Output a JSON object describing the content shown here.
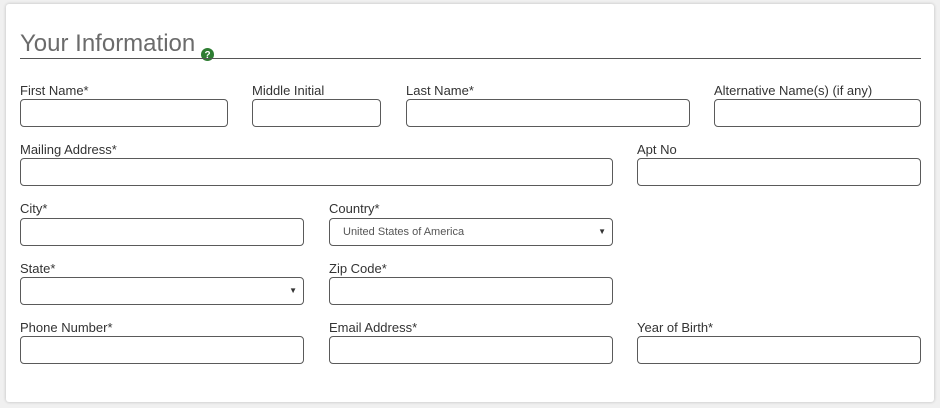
{
  "section": {
    "title": "Your Information",
    "help_icon": "help-circle-icon"
  },
  "fields": {
    "first_name": {
      "label": "First Name*",
      "value": ""
    },
    "middle_initial": {
      "label": "Middle Initial",
      "value": ""
    },
    "last_name": {
      "label": "Last Name*",
      "value": ""
    },
    "alt_name": {
      "label": "Alternative Name(s) (if any)",
      "value": ""
    },
    "mailing_address": {
      "label": "Mailing Address*",
      "value": ""
    },
    "apt_no": {
      "label": "Apt No",
      "value": ""
    },
    "city": {
      "label": "City*",
      "value": ""
    },
    "country": {
      "label": "Country*",
      "selected": "United States of America"
    },
    "state": {
      "label": "State*",
      "selected": ""
    },
    "zip": {
      "label": "Zip Code*",
      "value": ""
    },
    "phone": {
      "label": "Phone Number*",
      "value": ""
    },
    "email": {
      "label": "Email Address*",
      "value": ""
    },
    "year_of_birth": {
      "label": "Year of Birth*",
      "value": ""
    }
  },
  "colors": {
    "help_icon": "#2e7d32",
    "rule": "#555555"
  }
}
